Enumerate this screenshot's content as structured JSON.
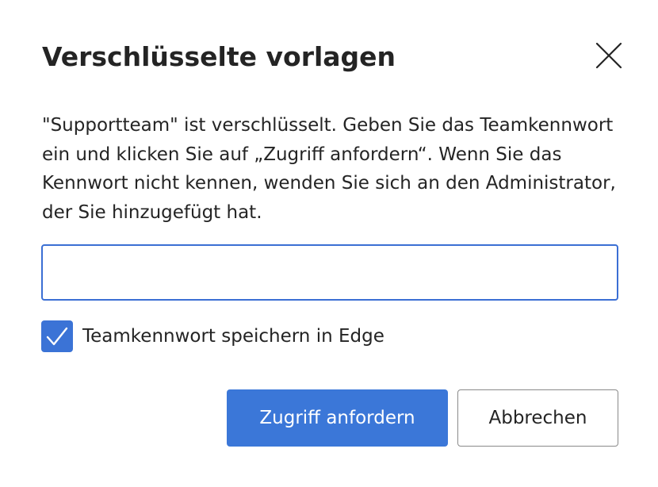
{
  "dialog": {
    "title": "Verschlüsselte vorlagen",
    "close_icon": "close-icon",
    "description": "\"Supportteam\" ist verschlüsselt. Geben Sie das Teamkennwort ein und klicken Sie auf „Zugriff anfordern“. Wenn Sie das Kennwort nicht kennen, wenden Sie sich an den Administrator, der Sie hinzugefügt hat.",
    "password_field": {
      "value": "",
      "placeholder": ""
    },
    "save_password_checkbox": {
      "label": "Teamkennwort speichern in Edge",
      "checked": true,
      "icon": "checkmark-icon"
    },
    "buttons": {
      "primary_label": "Zugriff anfordern",
      "secondary_label": "Abbrechen"
    }
  },
  "colors": {
    "accent": "#3b77d8",
    "input_border": "#3b6fd4",
    "text": "#242424",
    "secondary_border": "#8a8a8a"
  }
}
